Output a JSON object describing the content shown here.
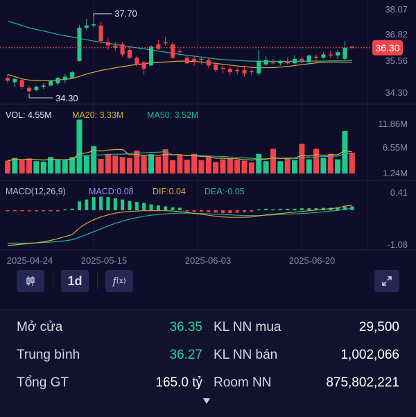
{
  "price_chart": {
    "axis_labels": [
      "38.07",
      "36.82",
      "35.56",
      "34.30"
    ],
    "current_price": "36.30",
    "high_label": "37.70",
    "low_label": "34.30"
  },
  "volume_panel": {
    "vol_label": "VOL: 4.55M",
    "ma20_label": "MA20: 3.33M",
    "ma50_label": "MA50: 3.52M",
    "axis_labels": [
      "11.86M",
      "6.55M",
      "1.24M"
    ]
  },
  "macd_panel": {
    "title": "MACD(12,26,9)",
    "macd_label": "MACD:0.08",
    "dif_label": "DIF:0.04",
    "dea_label": "DEA:-0.05",
    "axis_labels": [
      "0.41",
      "-1.08"
    ]
  },
  "date_labels": [
    "2025-04-24",
    "2025-05-15",
    "2025-06-03",
    "2025-06-20"
  ],
  "toolbar": {
    "interval_label": "1d",
    "candles_icon": "candlestick-icon",
    "indicator_icon": "function-icon",
    "expand_icon": "expand-icon"
  },
  "stats": {
    "open_label": "Mở cửa",
    "open_value": "36.35",
    "avg_label": "Trung bình",
    "avg_value": "36.27",
    "total_label": "Tổng GT",
    "total_value": "165.0 tỷ",
    "nn_buy_label": "KL NN mua",
    "nn_buy_value": "29,500",
    "nn_sell_label": "KL NN bán",
    "nn_sell_value": "1,002,066",
    "room_label": "Room NN",
    "room_value": "875,802,221"
  },
  "colors": {
    "up": "#1fc98a",
    "down": "#f0434b",
    "ma20": "#d9a93c",
    "ma50": "#1fb896",
    "macd": "#9b8cff",
    "background": "#0f0e2a"
  },
  "chart_data": {
    "type": "candlestick",
    "price_range": [
      34.3,
      38.07
    ],
    "candles": [
      {
        "o": 34.95,
        "h": 35.1,
        "l": 34.7,
        "c": 34.82
      },
      {
        "o": 34.75,
        "h": 34.95,
        "l": 34.55,
        "c": 34.9
      },
      {
        "o": 34.85,
        "h": 34.95,
        "l": 34.45,
        "c": 34.55
      },
      {
        "o": 34.5,
        "h": 34.6,
        "l": 34.3,
        "c": 34.35
      },
      {
        "o": 34.4,
        "h": 34.6,
        "l": 34.35,
        "c": 34.55
      },
      {
        "o": 34.55,
        "h": 34.7,
        "l": 34.45,
        "c": 34.6
      },
      {
        "o": 34.6,
        "h": 34.85,
        "l": 34.55,
        "c": 34.8
      },
      {
        "o": 34.7,
        "h": 35.0,
        "l": 34.6,
        "c": 34.95
      },
      {
        "o": 34.85,
        "h": 35.1,
        "l": 34.7,
        "c": 35.0
      },
      {
        "o": 34.95,
        "h": 35.25,
        "l": 34.9,
        "c": 35.2
      },
      {
        "o": 35.7,
        "h": 37.3,
        "l": 35.7,
        "c": 37.2
      },
      {
        "o": 37.2,
        "h": 37.6,
        "l": 37.1,
        "c": 37.3
      },
      {
        "o": 37.3,
        "h": 37.7,
        "l": 37.2,
        "c": 37.35
      },
      {
        "o": 37.3,
        "h": 37.45,
        "l": 36.5,
        "c": 36.6
      },
      {
        "o": 36.55,
        "h": 36.75,
        "l": 36.2,
        "c": 36.4
      },
      {
        "o": 36.4,
        "h": 36.55,
        "l": 36.15,
        "c": 36.3
      },
      {
        "o": 36.45,
        "h": 36.55,
        "l": 35.9,
        "c": 36.0
      },
      {
        "o": 36.2,
        "h": 36.35,
        "l": 35.8,
        "c": 35.85
      },
      {
        "o": 35.85,
        "h": 35.95,
        "l": 35.45,
        "c": 35.55
      },
      {
        "o": 35.65,
        "h": 35.7,
        "l": 35.1,
        "c": 35.35
      },
      {
        "o": 35.5,
        "h": 36.4,
        "l": 35.5,
        "c": 36.35
      },
      {
        "o": 36.45,
        "h": 36.65,
        "l": 36.2,
        "c": 36.25
      },
      {
        "o": 36.55,
        "h": 36.8,
        "l": 36.4,
        "c": 36.5
      },
      {
        "o": 36.45,
        "h": 36.55,
        "l": 35.8,
        "c": 35.85
      },
      {
        "o": 36.15,
        "h": 36.25,
        "l": 35.95,
        "c": 36.1
      },
      {
        "o": 35.85,
        "h": 35.95,
        "l": 35.55,
        "c": 35.6
      },
      {
        "o": 35.8,
        "h": 35.95,
        "l": 35.5,
        "c": 35.7
      },
      {
        "o": 35.8,
        "h": 35.9,
        "l": 35.55,
        "c": 35.75
      },
      {
        "o": 35.75,
        "h": 35.85,
        "l": 35.4,
        "c": 35.5
      },
      {
        "o": 35.55,
        "h": 35.65,
        "l": 35.2,
        "c": 35.3
      },
      {
        "o": 35.4,
        "h": 35.5,
        "l": 35.15,
        "c": 35.35
      },
      {
        "o": 35.35,
        "h": 35.45,
        "l": 35.05,
        "c": 35.2
      },
      {
        "o": 35.3,
        "h": 35.4,
        "l": 35.1,
        "c": 35.25
      },
      {
        "o": 35.3,
        "h": 35.5,
        "l": 35.0,
        "c": 35.15
      },
      {
        "o": 35.25,
        "h": 35.35,
        "l": 35.05,
        "c": 35.2
      },
      {
        "o": 35.15,
        "h": 36.2,
        "l": 35.05,
        "c": 35.7
      },
      {
        "o": 35.55,
        "h": 35.9,
        "l": 35.5,
        "c": 35.75
      },
      {
        "o": 35.65,
        "h": 35.8,
        "l": 35.55,
        "c": 35.6
      },
      {
        "o": 35.6,
        "h": 35.75,
        "l": 35.5,
        "c": 35.7
      },
      {
        "o": 35.7,
        "h": 35.85,
        "l": 35.55,
        "c": 35.6
      },
      {
        "o": 35.6,
        "h": 35.95,
        "l": 35.55,
        "c": 35.8
      },
      {
        "o": 35.8,
        "h": 35.9,
        "l": 35.6,
        "c": 35.7
      },
      {
        "o": 35.65,
        "h": 36.0,
        "l": 35.6,
        "c": 35.95
      },
      {
        "o": 35.9,
        "h": 36.0,
        "l": 35.7,
        "c": 35.85
      },
      {
        "o": 35.85,
        "h": 36.1,
        "l": 35.8,
        "c": 36.0
      },
      {
        "o": 36.0,
        "h": 36.15,
        "l": 35.85,
        "c": 35.95
      },
      {
        "o": 35.95,
        "h": 36.2,
        "l": 35.8,
        "c": 36.1
      },
      {
        "o": 35.8,
        "h": 36.6,
        "l": 35.7,
        "c": 36.3
      },
      {
        "o": 36.35,
        "h": 36.4,
        "l": 36.25,
        "c": 36.3
      }
    ],
    "volumes": [
      2.8,
      3.4,
      2.9,
      3.3,
      2.7,
      2.6,
      3.6,
      2.9,
      3.1,
      3.6,
      11.8,
      3.9,
      6.0,
      3.2,
      4.3,
      3.9,
      3.6,
      3.4,
      5.0,
      4.0,
      4.2,
      3.7,
      5.3,
      2.9,
      4.0,
      3.0,
      4.3,
      2.9,
      3.6,
      2.5,
      3.1,
      3.3,
      3.0,
      2.8,
      2.4,
      4.3,
      2.7,
      5.4,
      2.7,
      3.3,
      2.9,
      6.5,
      3.1,
      5.4,
      3.4,
      4.3,
      3.1,
      9.3,
      4.55
    ],
    "ma20_price": [
      35.1,
      35.0,
      34.9,
      34.85,
      34.83,
      34.82,
      34.82,
      34.85,
      34.88,
      34.92,
      35.02,
      35.12,
      35.2,
      35.28,
      35.34,
      35.4,
      35.45,
      35.5,
      35.55,
      35.58,
      35.62,
      35.64,
      35.66,
      35.68,
      35.7,
      35.7,
      35.68,
      35.66,
      35.63,
      35.6,
      35.56,
      35.52,
      35.48,
      35.45,
      35.42,
      35.4,
      35.4,
      35.41,
      35.43,
      35.46,
      35.5,
      35.54,
      35.58,
      35.62,
      35.65,
      35.66,
      35.66,
      35.65,
      35.65
    ],
    "ma50_price": [
      37.5,
      37.4,
      37.3,
      37.2,
      37.12,
      37.05,
      36.98,
      36.9,
      36.84,
      36.78,
      36.72,
      36.66,
      36.6,
      36.55,
      36.5,
      36.45,
      36.4,
      36.35,
      36.3,
      36.25,
      36.2,
      36.15,
      36.1,
      36.05,
      36.0,
      35.96,
      35.92,
      35.88,
      35.84,
      35.8,
      35.77,
      35.75,
      35.73,
      35.71,
      35.7,
      35.7,
      35.69,
      35.69,
      35.69,
      35.69,
      35.69,
      35.69,
      35.7,
      35.7,
      35.7,
      35.71,
      35.71,
      35.71,
      35.72
    ],
    "macd_hist": [
      -0.02,
      -0.02,
      -0.02,
      -0.02,
      -0.02,
      -0.02,
      -0.02,
      -0.02,
      0.02,
      0.03,
      0.18,
      0.22,
      0.27,
      0.28,
      0.27,
      0.25,
      0.22,
      0.19,
      0.17,
      0.15,
      0.12,
      0.1,
      0.08,
      0.06,
      0.05,
      -0.02,
      -0.03,
      -0.03,
      -0.04,
      -0.05,
      -0.06,
      -0.06,
      -0.05,
      -0.04,
      -0.03,
      0.02,
      0.03,
      0.02,
      0.03,
      0.03,
      0.03,
      0.04,
      0.04,
      0.04,
      0.05,
      0.05,
      0.06,
      0.07,
      0.08
    ],
    "dif": [
      -1.12,
      -1.1,
      -1.08,
      -1.06,
      -1.04,
      -1.01,
      -0.97,
      -0.92,
      -0.86,
      -0.8,
      -0.62,
      -0.48,
      -0.38,
      -0.3,
      -0.24,
      -0.19,
      -0.16,
      -0.14,
      -0.13,
      -0.12,
      -0.12,
      -0.12,
      -0.12,
      -0.13,
      -0.14,
      -0.17,
      -0.2,
      -0.22,
      -0.25,
      -0.28,
      -0.3,
      -0.31,
      -0.31,
      -0.31,
      -0.3,
      -0.27,
      -0.24,
      -0.22,
      -0.2,
      -0.18,
      -0.16,
      -0.14,
      -0.12,
      -0.1,
      -0.08,
      -0.06,
      -0.04,
      0.01,
      0.04
    ],
    "dea": [
      -1.05,
      -1.05,
      -1.05,
      -1.05,
      -1.04,
      -1.03,
      -1.02,
      -1.0,
      -0.98,
      -0.95,
      -0.88,
      -0.8,
      -0.72,
      -0.64,
      -0.56,
      -0.48,
      -0.42,
      -0.36,
      -0.32,
      -0.28,
      -0.25,
      -0.23,
      -0.21,
      -0.2,
      -0.19,
      -0.19,
      -0.19,
      -0.2,
      -0.21,
      -0.22,
      -0.23,
      -0.24,
      -0.25,
      -0.26,
      -0.26,
      -0.26,
      -0.25,
      -0.24,
      -0.23,
      -0.22,
      -0.21,
      -0.2,
      -0.19,
      -0.17,
      -0.15,
      -0.13,
      -0.11,
      -0.08,
      -0.05
    ]
  }
}
